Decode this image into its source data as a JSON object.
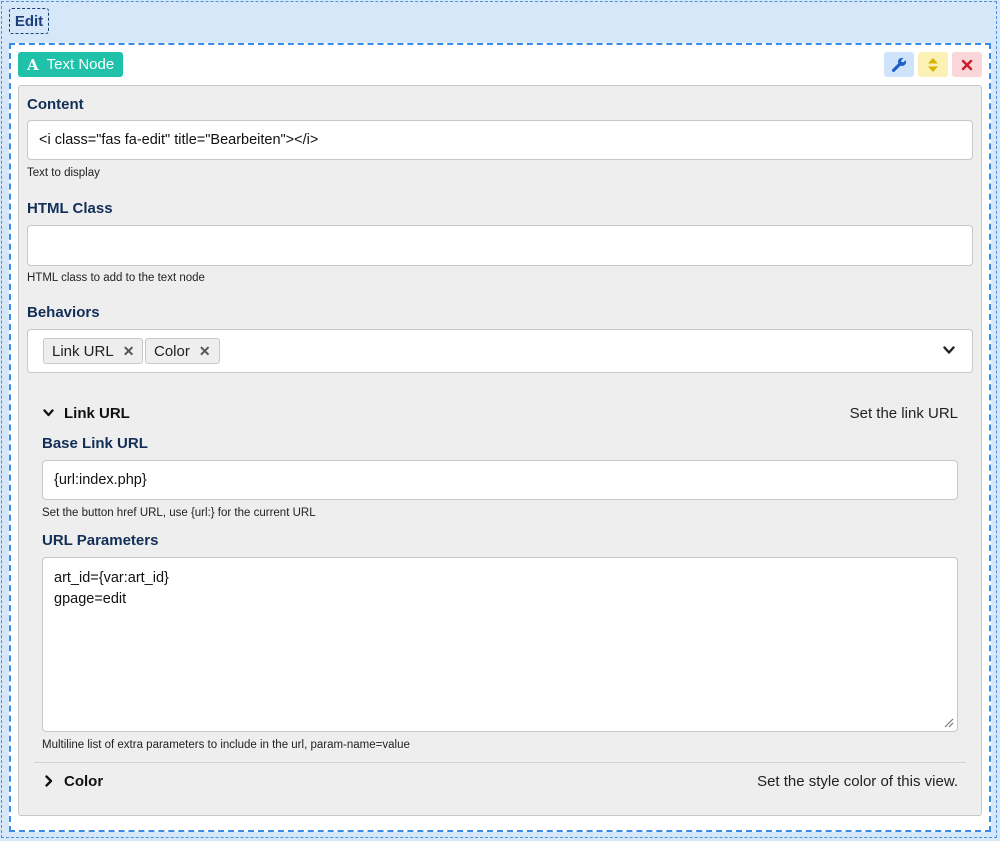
{
  "header": {
    "edit_label": "Edit"
  },
  "node": {
    "badge_label": "Text Node",
    "badge_icon": "text-A-icon",
    "actions": [
      {
        "name": "settings",
        "icon": "wrench-icon",
        "color": "#1d5ec9"
      },
      {
        "name": "move",
        "icon": "sort-arrows-icon",
        "color": "#d9b300"
      },
      {
        "name": "remove",
        "icon": "close-icon",
        "color": "#cc1b2b"
      }
    ]
  },
  "form": {
    "content": {
      "label": "Content",
      "value": "<i class=\"fas fa-edit\" title=\"Bearbeiten\"></i>",
      "help": "Text to display"
    },
    "html_class": {
      "label": "HTML Class",
      "value": "",
      "help": "HTML class to add to the text node"
    },
    "behaviors": {
      "label": "Behaviors",
      "chips": [
        "Link URL",
        "Color"
      ],
      "remove_glyph": "✕"
    }
  },
  "link_url": {
    "title": "Link URL",
    "description": "Set the link URL",
    "base": {
      "label": "Base Link URL",
      "value": "{url:index.php}",
      "help": "Set the button href URL, use {url:} for the current URL"
    },
    "params": {
      "label": "URL Parameters",
      "value": "art_id={var:art_id}\ngpage=edit",
      "help": "Multiline list of extra parameters to include in the url, param-name=value"
    }
  },
  "color": {
    "title": "Color",
    "description": "Set the style color of this view."
  },
  "colors": {
    "accent_teal": "#1fc1a8",
    "label_navy": "#132f58",
    "frame_blue": "#3b8be8"
  }
}
